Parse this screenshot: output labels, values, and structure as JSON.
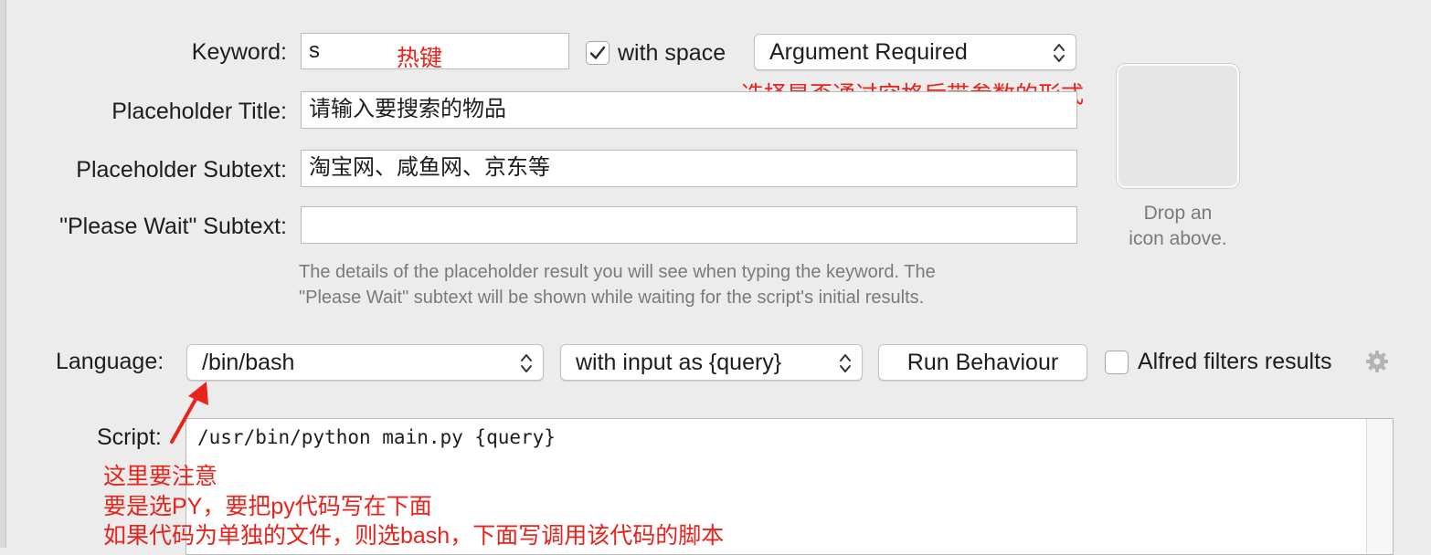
{
  "labels": {
    "keyword": "Keyword:",
    "placeholder_title": "Placeholder Title:",
    "placeholder_subtext": "Placeholder Subtext:",
    "please_wait": "\"Please Wait\" Subtext:",
    "language": "Language:",
    "script": "Script:"
  },
  "keyword": {
    "value": "s",
    "with_space_checked": true,
    "with_space_label": "with space",
    "argument_mode": "Argument Required"
  },
  "placeholder_title": {
    "value": "请输入要搜索的物品"
  },
  "placeholder_subtext": {
    "value": "淘宝网、咸鱼网、京东等"
  },
  "please_wait": {
    "value": ""
  },
  "help": {
    "line1": "The details of the placeholder result you will see when typing the keyword. The",
    "line2": "\"Please Wait\" subtext will be shown while waiting for the script's initial results."
  },
  "icon_well": {
    "line1": "Drop an",
    "line2": "icon above."
  },
  "language": {
    "value": "/bin/bash",
    "input_mode": "with input as {query}",
    "run_behaviour": "Run Behaviour",
    "alfred_filters_checked": false,
    "alfred_filters_label": "Alfred filters results"
  },
  "script": {
    "code": "/usr/bin/python main.py {query}"
  },
  "annotations": {
    "hotkey": "热键",
    "argument_note": "选择是否通过空格后带参数的形式",
    "note1": "这里要注意",
    "note2": "要是选PY，要把py代码写在下面",
    "note3": "如果代码为单独的文件，则选bash，下面写调用该代码的脚本"
  },
  "colors": {
    "annotation": "#e8231b",
    "help_text": "#7a7a7a",
    "background": "#ececec"
  },
  "icons": {
    "settings": "gear-icon",
    "checkmark": "checkmark-icon",
    "stepper": "updown-arrows-icon",
    "arrow": "red-arrow-icon"
  }
}
